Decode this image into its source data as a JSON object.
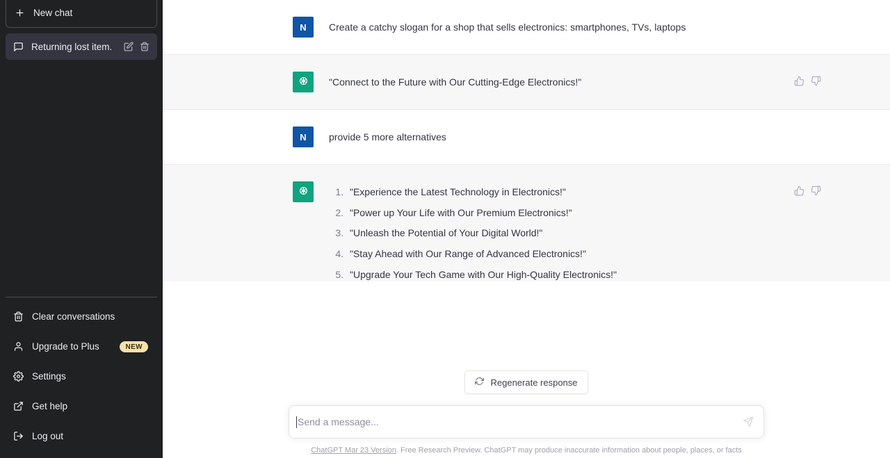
{
  "sidebar": {
    "new_chat_label": "New chat",
    "conversations": [
      {
        "title": "Returning lost item.",
        "chat_icon": "chat-bubble-icon",
        "edit_icon": "pencil-icon",
        "delete_icon": "trash-icon",
        "active": true
      }
    ],
    "menu": [
      {
        "label": "Clear conversations",
        "icon": "trash-icon",
        "badge": ""
      },
      {
        "label": "Upgrade to Plus",
        "icon": "user-icon",
        "badge": "NEW"
      },
      {
        "label": "Settings",
        "icon": "gear-icon",
        "badge": ""
      },
      {
        "label": "Get help",
        "icon": "external-link-icon",
        "badge": ""
      },
      {
        "label": "Log out",
        "icon": "logout-icon",
        "badge": ""
      }
    ],
    "background_color": "#202123",
    "active_item_color": "#343541",
    "badge_color": "#f6e2ab"
  },
  "conversation": {
    "messages": [
      {
        "role": "user",
        "avatar_initial": "N",
        "avatar_color": "#1155a5",
        "text": "Create a catchy slogan for a shop that sells electronics: smartphones, TVs, laptops",
        "has_feedback": false
      },
      {
        "role": "assistant",
        "avatar_icon": "openai-logo-icon",
        "avatar_color": "#10a37f",
        "text": "\"Connect to the Future with Our Cutting-Edge Electronics!\"",
        "has_feedback": true
      },
      {
        "role": "user",
        "avatar_initial": "N",
        "avatar_color": "#1155a5",
        "text": "provide 5 more alternatives",
        "has_feedback": false
      },
      {
        "role": "assistant",
        "avatar_icon": "openai-logo-icon",
        "avatar_color": "#10a37f",
        "has_feedback": true,
        "list_items": [
          "\"Experience the Latest Technology in Electronics!\"",
          "\"Power up Your Life with Our Premium Electronics!\"",
          "\"Unleash the Potential of Your Digital World!\"",
          "\"Stay Ahead with Our Range of Advanced Electronics!\"",
          "\"Upgrade Your Tech Game with Our High-Quality Electronics!\""
        ]
      }
    ],
    "feedback": {
      "thumbs_up_icon": "thumbs-up-icon",
      "thumbs_down_icon": "thumbs-down-icon"
    }
  },
  "composer": {
    "regenerate_label": "Regenerate response",
    "regenerate_icon": "refresh-icon",
    "input_placeholder": "Send a message...",
    "input_value": "",
    "send_icon": "send-paper-plane-icon",
    "footer_link": "ChatGPT Mar 23 Version",
    "footer_text": ". Free Research Preview. ChatGPT may produce inaccurate information about people, places, or facts"
  }
}
